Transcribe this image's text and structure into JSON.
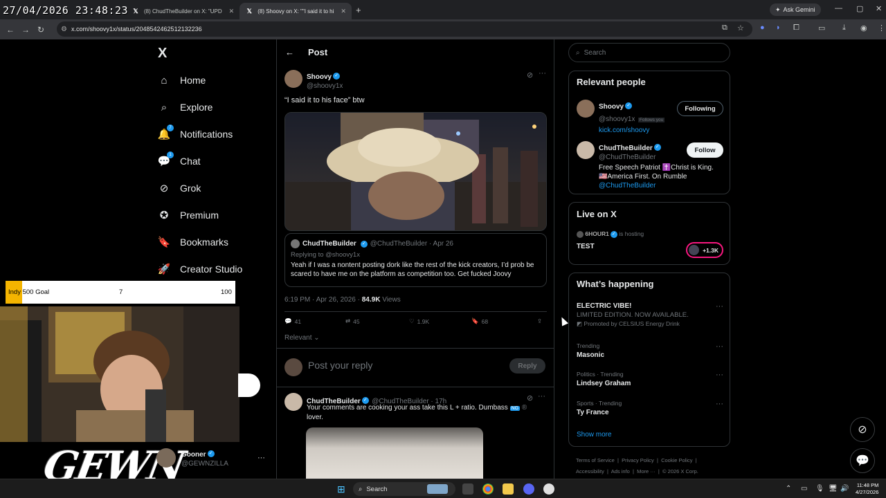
{
  "overlay": {
    "timestamp": "27/04/2026 23:48:23"
  },
  "browser": {
    "tabs": [
      {
        "label": "(8) ChudTheBuilder on X: \"UPD",
        "active": false
      },
      {
        "label": "(8) Shoovy on X: \"\"I said it to hi",
        "active": true
      }
    ],
    "gemini_label": "Ask Gemini",
    "url": "x.com/shoovy1x/status/2048542462512132236"
  },
  "x_nav": {
    "logo": "X",
    "items": [
      {
        "label": "Home",
        "icon": "home-icon"
      },
      {
        "label": "Explore",
        "icon": "search-icon"
      },
      {
        "label": "Notifications",
        "icon": "bell-icon",
        "badge": "7"
      },
      {
        "label": "Chat",
        "icon": "chat-icon",
        "badge": "1"
      },
      {
        "label": "Grok",
        "icon": "grok-icon"
      },
      {
        "label": "Premium",
        "icon": "premium-icon"
      },
      {
        "label": "Bookmarks",
        "icon": "bookmark-icon"
      },
      {
        "label": "Creator Studio",
        "icon": "rocket-icon"
      }
    ],
    "account": {
      "name": "Gooner",
      "handle": "@GEWNZILLA"
    }
  },
  "post": {
    "header": "Post",
    "author": {
      "name": "Shoovy",
      "handle": "@shoovy1x"
    },
    "text": "“I said it to his face” btw",
    "quote": {
      "author": "ChudTheBuilder",
      "handle_date": "@ChudTheBuilder · Apr 26",
      "replying_to": "Replying to @shoovy1x",
      "text": "Yeah if I was a nontent posting dork like the rest of the kick creators, I’d prob be scared to have me on the platform as competition too. Get fucked Joovy"
    },
    "meta_time": "6:19 PM · Apr 26, 2026 · ",
    "meta_views": "84.9K",
    "meta_views_label": " Views",
    "actions": {
      "replies": "41",
      "reposts": "45",
      "likes": "1.9K",
      "bookmarks": "68"
    },
    "sort_label": "Relevant",
    "reply_placeholder": "Post your reply",
    "reply_button": "Reply",
    "reply": {
      "author": "ChudTheBuilder",
      "handle_date": "@ChudTheBuilder · 17h",
      "text": "Your comments are cooking your ass take this L + ratio. Dumbass",
      "text_end": "lover.",
      "emoji_tag": "NG"
    }
  },
  "right": {
    "search_placeholder": "Search",
    "relevant_title": "Relevant people",
    "people": [
      {
        "name": "Shoovy",
        "handle": "@shoovy1x",
        "follows_you": "Follows you",
        "bio": "kick.com/shoovy",
        "button": "Following"
      },
      {
        "name": "ChudTheBuilder",
        "handle": "@ChudTheBuilder",
        "bio": "Free Speech Patriot ✝️Christ is King. 🇺🇸America First. On Rumble",
        "bio_link": "@ChudTheBuilder",
        "button": "Follow"
      }
    ],
    "live_title": "Live on X",
    "live": {
      "host": "6HOUR1",
      "hosting": "is hosting",
      "title": "TEST",
      "count": "+1.3K"
    },
    "happening_title": "What’s happening",
    "trends": [
      {
        "category": "",
        "name": "ELECTRIC VIBE!",
        "sub": "LIMITED EDITION. NOW AVAILABLE.",
        "promo": "Promoted by CELSIUS Energy Drink"
      },
      {
        "category": "Trending",
        "name": "Masonic"
      },
      {
        "category": "Politics · Trending",
        "name": "Lindsey Graham"
      },
      {
        "category": "Sports · Trending",
        "name": "Ty France"
      }
    ],
    "show_more": "Show more",
    "footer_row1": "Terms of Service  |  Privacy Policy  |  Cookie Policy  |",
    "footer_row2": "Accessibility  |  Ads info  |  More ···  |  © 2026 X Corp."
  },
  "stream": {
    "goal_name": "Indy 500 Goal",
    "goal_current": "7",
    "goal_target": "100",
    "goal_progress": 0.07,
    "brand": "GEWN"
  },
  "taskbar": {
    "search_label": "Search",
    "time": "11:48 PM",
    "date": "4/27/2026"
  },
  "colors": {
    "accent": "#1d9bf0",
    "background": "#000000",
    "border": "#2f3336",
    "muted": "#71767b"
  }
}
